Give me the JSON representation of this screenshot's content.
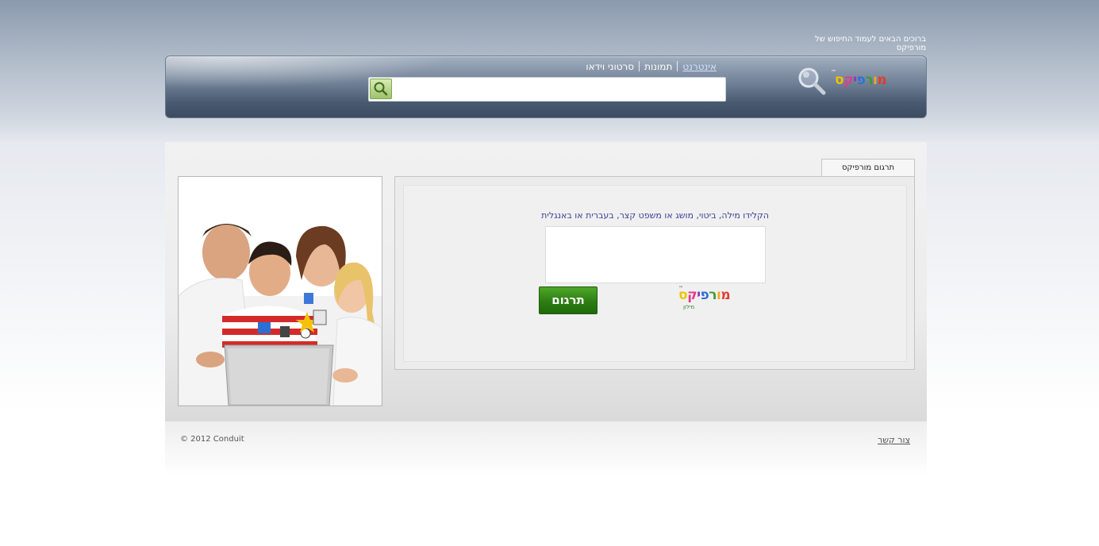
{
  "welcome_text": "ברוכים הבאים לעמוד החיפוש של מורפיקס",
  "header": {
    "nav": {
      "internet": "אינטרנט",
      "images": "תמונות",
      "videos": "סרטוני וידאו"
    },
    "search": {
      "value": "",
      "placeholder": ""
    },
    "logo": {
      "tm": "™",
      "letters": [
        "מ",
        "ו",
        "ר",
        "פ",
        "י",
        "ק",
        "ס"
      ]
    }
  },
  "translation": {
    "tab_label": "תרגום מורפיקס",
    "instructions": "הקלידו מילה, ביטוי, מושג או משפט קצר, בעברית או באנגלית",
    "input_value": "",
    "button_label": "תרגום",
    "logo_tm": "™",
    "logo_sub": "מילון"
  },
  "footer": {
    "contact": "צור קשר",
    "copyright": "© 2012 Conduit"
  },
  "colors": {
    "logo_letters": [
      "#e23b2e",
      "#f5a623",
      "#3a9b35",
      "#2f6fd6",
      "#8a3ab9",
      "#e23b8a",
      "#f2c200"
    ],
    "button_green": "#2d7d13",
    "instruction_text": "#3b3f99"
  }
}
